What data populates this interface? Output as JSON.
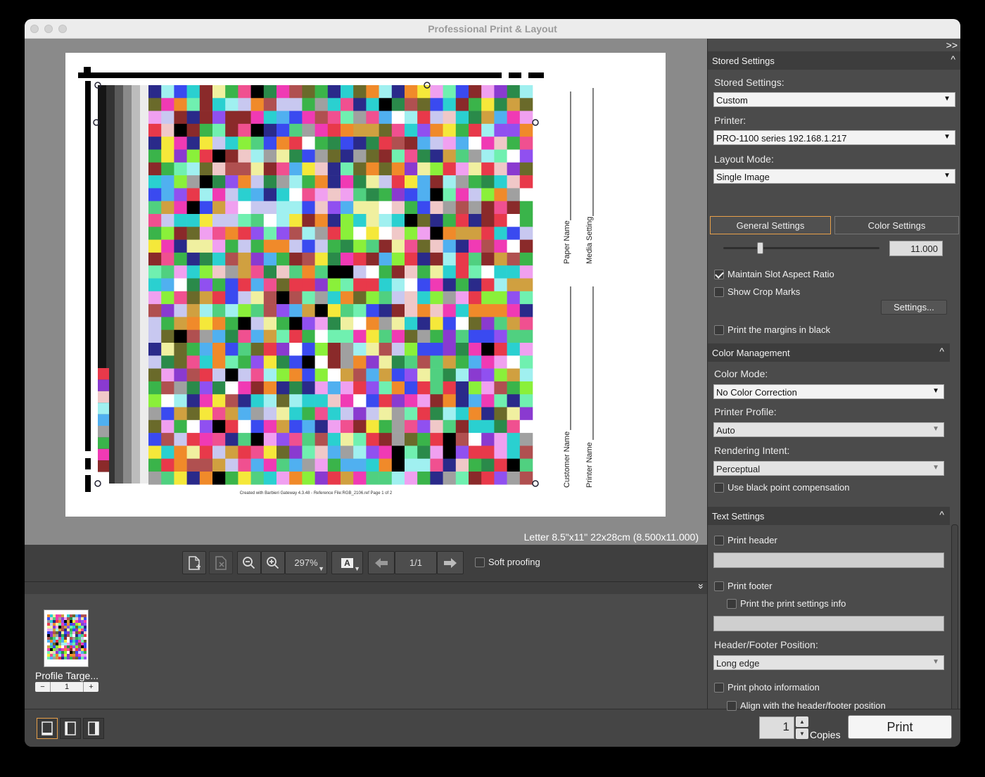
{
  "window": {
    "title": "Professional Print & Layout"
  },
  "preview": {
    "paper_size": "Letter 8.5\"x11\" 22x28cm (8.500x11.000)",
    "footer_note": "Created with Barbieri Gateway 4.3.48 - Reference File:RGB_2106.ref Page 1 of 2",
    "field_labels": [
      "Paper Name",
      "Media Setting",
      "Customer Name",
      "Printer Name"
    ]
  },
  "toolbar": {
    "zoom": "297%",
    "page": "1/1",
    "soft_proofing": "Soft proofing",
    "font_icon": "A"
  },
  "thumbnails": [
    {
      "label": "Profile Targe...",
      "copies": "1"
    }
  ],
  "stepper": {
    "minus": "−",
    "plus": "+"
  },
  "bottom": {
    "copies_value": "1",
    "copies_label": "Copies",
    "print_label": "Print"
  },
  "panel": {
    "expand_icon": ">>",
    "stored_settings": {
      "header": "Stored Settings",
      "stored_label": "Stored Settings:",
      "stored_value": "Custom",
      "printer_label": "Printer:",
      "printer_value": "PRO-1100 series 192.168.1.217",
      "layout_label": "Layout Mode:",
      "layout_value": "Single Image"
    },
    "tabs": [
      "General Settings",
      "Color Settings"
    ],
    "general": {
      "slider_value": "11.000",
      "maintain_aspect": "Maintain Slot Aspect Ratio",
      "show_crop": "Show Crop Marks",
      "settings_button": "Settings...",
      "margins_black": "Print the margins in black"
    },
    "color_management": {
      "header": "Color Management",
      "mode_label": "Color Mode:",
      "mode_value": "No Color Correction",
      "profile_label": "Printer Profile:",
      "profile_value": "Auto",
      "intent_label": "Rendering Intent:",
      "intent_value": "Perceptual",
      "black_point": "Use black point compensation"
    },
    "text_settings": {
      "header": "Text Settings",
      "print_header": "Print header",
      "print_footer": "Print footer",
      "print_settings_info": "Print the print settings info",
      "position_label": "Header/Footer Position:",
      "position_value": "Long edge",
      "photo_info": "Print photo information",
      "align_position": "Align with the header/footer position"
    }
  }
}
